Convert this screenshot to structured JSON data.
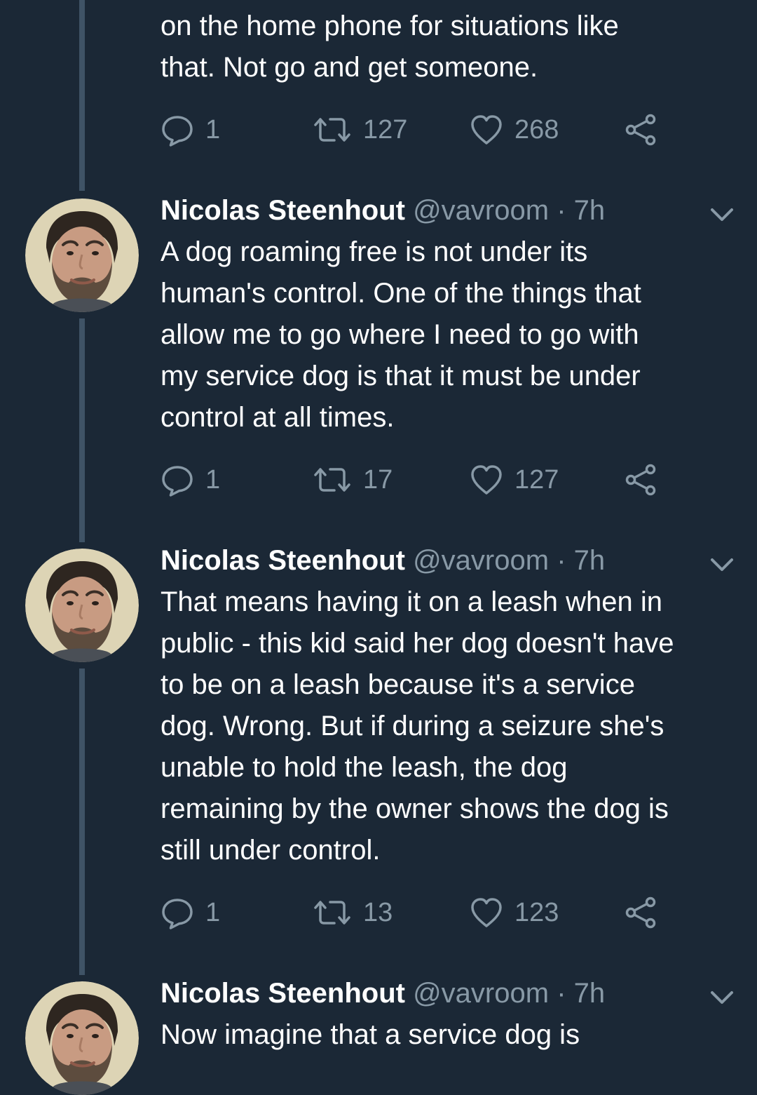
{
  "colors": {
    "background": "#1b2836",
    "text_primary": "#ffffff",
    "text_secondary": "#8899a6",
    "thread_line": "#3f5366"
  },
  "icons": {
    "reply": "speech-bubble-icon",
    "retweet": "retweet-arrows-icon",
    "like": "heart-icon",
    "share": "share-nodes-icon",
    "menu": "chevron-down-icon"
  },
  "tweets": [
    {
      "text": "on the home phone for situations like\nthat. Not go and get someone.",
      "actions": {
        "replies": "1",
        "retweets": "127",
        "likes": "268"
      }
    },
    {
      "author": {
        "name": "Nicolas Steenhout",
        "handle": "@vavroom",
        "separator": "·",
        "time": "7h"
      },
      "text": "A dog roaming free is not under its\nhuman's control. One of the things that\nallow me to go where I need to go with\nmy service dog is that it must be under\ncontrol at all times.",
      "actions": {
        "replies": "1",
        "retweets": "17",
        "likes": "127"
      }
    },
    {
      "author": {
        "name": "Nicolas Steenhout",
        "handle": "@vavroom",
        "separator": "·",
        "time": "7h"
      },
      "text": "That means having it on a leash when in\npublic - this kid said her dog doesn't have\nto be on a leash because it's a service\ndog. Wrong. But if during a seizure she's\nunable to hold the leash, the dog\nremaining by the owner shows the dog is\nstill under control.",
      "actions": {
        "replies": "1",
        "retweets": "13",
        "likes": "123"
      }
    },
    {
      "author": {
        "name": "Nicolas Steenhout",
        "handle": "@vavroom",
        "separator": "·",
        "time": "7h"
      },
      "text": "Now imagine that a service dog is"
    }
  ]
}
